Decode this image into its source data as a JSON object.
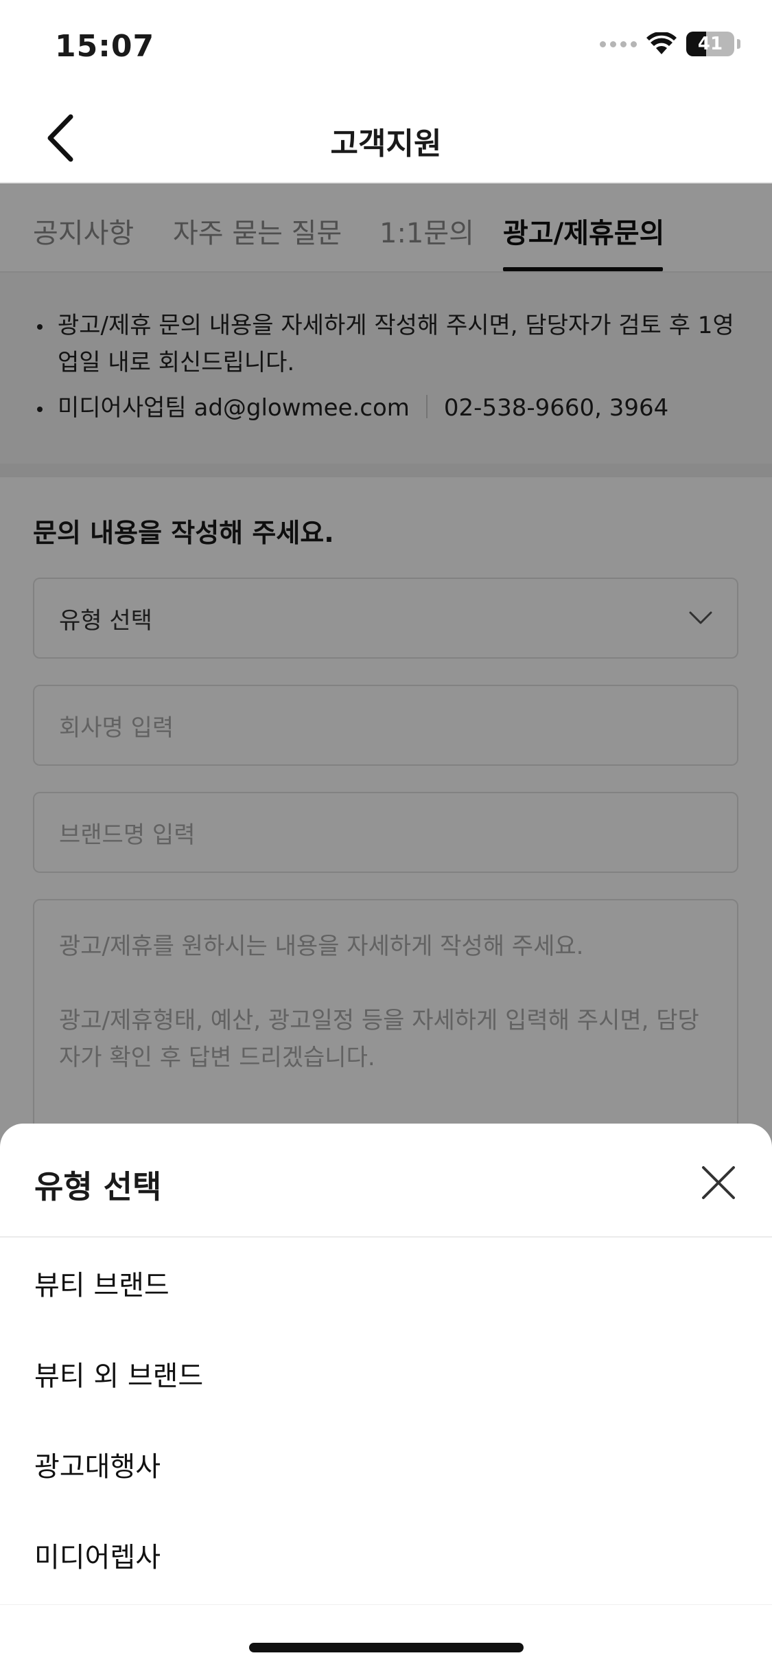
{
  "status_bar": {
    "time": "15:07",
    "battery_level": "41",
    "icons": [
      "signal-icon",
      "wifi-icon",
      "battery-icon"
    ]
  },
  "header": {
    "title": "고객지원",
    "back_icon": "chevron-left-icon"
  },
  "tabs": [
    {
      "label": "공지사항",
      "active": false
    },
    {
      "label": "자주 묻는 질문",
      "active": false
    },
    {
      "label": "1:1문의",
      "active": false
    },
    {
      "label": "광고/제휴문의",
      "active": true
    }
  ],
  "notice": {
    "line1": "광고/제휴 문의 내용을 자세하게 작성해 주시면, 담당자가 검토 후 1영업일 내로 회신드립니다.",
    "team": "미디어사업팀 ad@glowmee.com",
    "phone": "02-538-9660, 3964"
  },
  "form": {
    "heading": "문의 내용을 작성해 주세요.",
    "type_select_value": "유형 선택",
    "company_placeholder": "회사명 입력",
    "brand_placeholder": "브랜드명 입력",
    "message_placeholder_line1": "광고/제휴를 원하시는 내용을 자세하게 작성해 주세요.",
    "message_placeholder_line2": "광고/제휴형태, 예산, 광고일정 등을 자세하게 입력해 주시면, 담당자가 확인 후 답변 드리겠습니다."
  },
  "sheet": {
    "title": "유형 선택",
    "close_icon": "close-icon",
    "options": [
      "뷰티 브랜드",
      "뷰티 외 브랜드",
      "광고대행사",
      "미디어렙사"
    ]
  },
  "colors": {
    "text_primary": "#111111",
    "text_muted": "#888888",
    "overlay": "rgba(0,0,0,0.42)",
    "notice_bg": "#f4f4f4"
  }
}
